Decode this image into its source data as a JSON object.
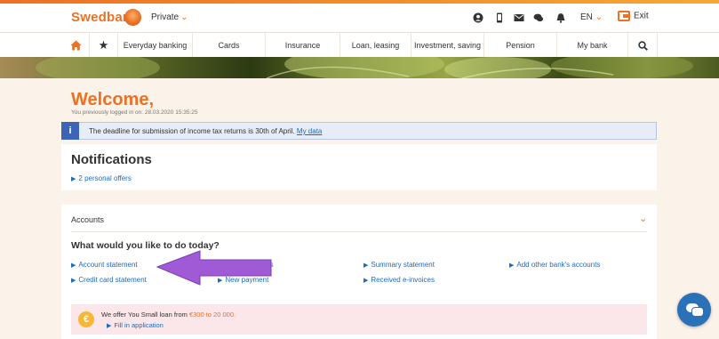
{
  "header": {
    "brand": "Swedbank",
    "segment": "Private",
    "language": "EN",
    "exit_label": "Exit",
    "icons": [
      "user-icon",
      "phone-icon",
      "mail-icon",
      "chat-bubbles-icon",
      "bell-icon"
    ]
  },
  "nav": {
    "items": [
      {
        "label": "Everyday banking"
      },
      {
        "label": "Cards"
      },
      {
        "label": "Insurance"
      },
      {
        "label": "Loan, leasing"
      },
      {
        "label": "Investment, saving"
      },
      {
        "label": "Pension"
      },
      {
        "label": "My bank"
      }
    ]
  },
  "welcome": {
    "title": "Welcome,",
    "last_login": "You previously logged in on: 28.03.2020 15:35:25"
  },
  "notice": {
    "icon": "i",
    "text": "The deadline for submission of income tax returns is 30th of April.",
    "link": "My data"
  },
  "notifications": {
    "title": "Notifications",
    "offers": "2 personal offers"
  },
  "accounts": {
    "title": "Accounts",
    "todo_title": "What would you like to do today?",
    "links": {
      "account_statement": "Account statement",
      "payments_partial": "nts",
      "summary_statement": "Summary statement",
      "add_other_bank": "Add other bank's accounts",
      "credit_card_statement": "Credit card statement",
      "new_payment": "New payment",
      "received_einvoices": "Received e-invoices"
    }
  },
  "loan": {
    "coin": "€",
    "text_before": "We offer You Small loan from ",
    "amount": "€300 to 20 000.",
    "fill": "Fill in application"
  },
  "colors": {
    "accent": "#ee7023",
    "link": "#1f6bb8",
    "annotation_arrow": "#a05ad6"
  }
}
